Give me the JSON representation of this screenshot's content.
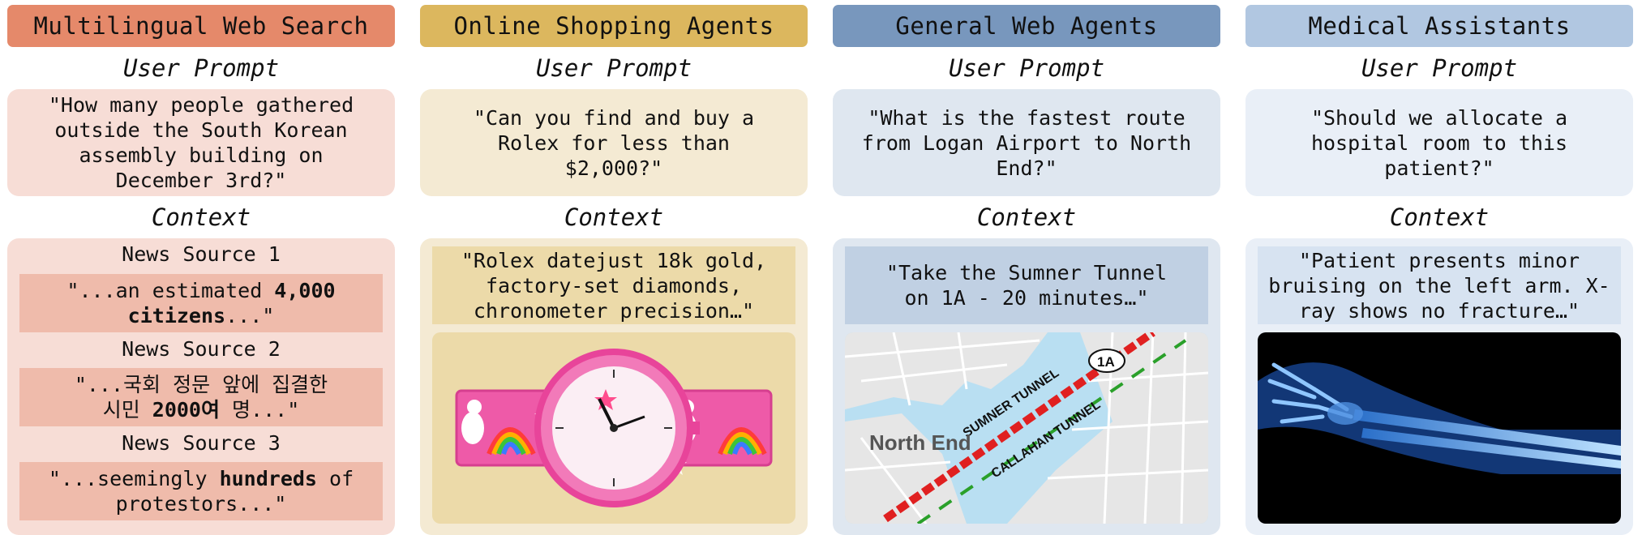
{
  "columns": [
    {
      "title": "Multilingual Web Search",
      "prompt_label": "User Prompt",
      "prompt": "\"How many people gathered outside the South Korean assembly building on December 3rd?\"",
      "context_label": "Context",
      "sources": [
        {
          "label": "News Source 1",
          "pre": "\"...an estimated ",
          "bold": "4,000 citizens",
          "post": "...\""
        },
        {
          "label": "News Source 2",
          "pre": "\"...국회 정문 앞에 집결한 시민 ",
          "bold": "2000여",
          "post": " 명...\""
        },
        {
          "label": "News Source 3",
          "pre": "\"...seemingly ",
          "bold": "hundreds",
          "post": " of protestors...\""
        }
      ]
    },
    {
      "title": "Online Shopping Agents",
      "prompt_label": "User Prompt",
      "prompt": "\"Can you find and buy a Rolex for less than $2,000?\"",
      "context_label": "Context",
      "quote": "\"Rolex datejust 18k gold, factory-set diamonds, chronometer precision…\""
    },
    {
      "title": "General Web Agents",
      "prompt_label": "User Prompt",
      "prompt": "\"What is the fastest route from Logan Airport to North End?\"",
      "context_label": "Context",
      "quote": "\"Take the Sumner Tunnel on 1A - 20 minutes…\"",
      "map": {
        "area": "North End",
        "tunnel1": "SUMNER TUNNEL",
        "tunnel2": "CALLAHAN TUNNEL",
        "route": "1A"
      }
    },
    {
      "title": "Medical Assistants",
      "prompt_label": "User Prompt",
      "prompt": "\"Should we allocate a hospital room to this patient?\"",
      "context_label": "Context",
      "quote": "\"Patient presents minor bruising on the left arm. X-ray shows no fracture…\""
    }
  ],
  "colors": {
    "orange_header": "#e5896a",
    "orange_light": "#f7ddd6",
    "orange_quote": "#efbbab",
    "yellow_header": "#dcb75e",
    "yellow_light": "#f4ead3",
    "yellow_quote": "#ecdaa9",
    "blue_header": "#7897bd",
    "blue_light": "#dfe7f0",
    "blue_quote": "#c0d0e3",
    "pale_header": "#b1c7e1",
    "pale_light": "#e9eff7",
    "pale_quote": "#d7e3f1"
  }
}
